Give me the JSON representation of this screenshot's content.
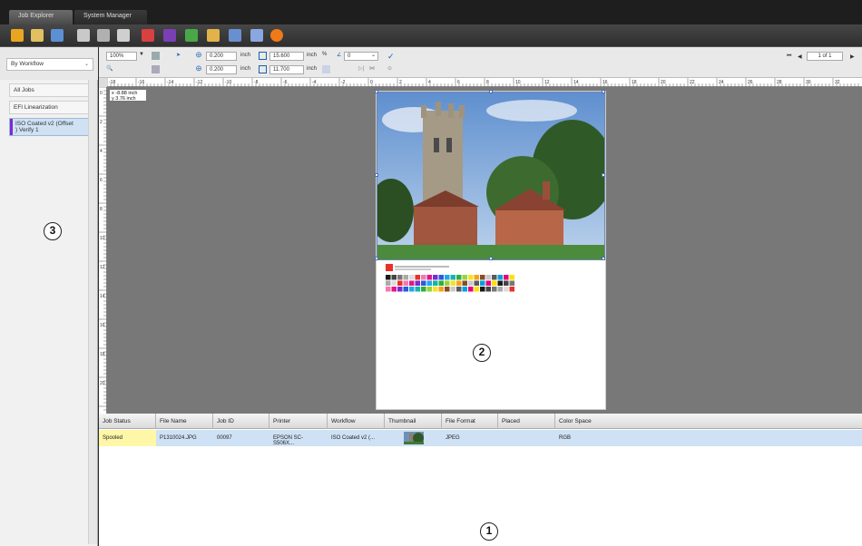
{
  "tabs": [
    {
      "label": "Job Explorer",
      "active": true
    },
    {
      "label": "System Manager",
      "active": false
    }
  ],
  "toolbar_icons": [
    "open-folder-icon",
    "folder-icon",
    "save-icon",
    "print-icon",
    "printer-settings-icon",
    "printer-icon",
    "delete-icon",
    "color-icon",
    "image-edit-icon",
    "layout-icon",
    "document-icon",
    "page-icon",
    "stop-icon"
  ],
  "left_panel": {
    "workflow_select": "By Workflow",
    "items": [
      {
        "label": "All Jobs"
      },
      {
        "label": "EFI Linearization"
      },
      {
        "label_line1": "ISO Coated v2 (Offset",
        "label_line2": ") Verify 1",
        "selected": true
      }
    ]
  },
  "options": {
    "zoom": "100%",
    "x_pos": "0.200",
    "y_pos": "0.200",
    "width": "15.600",
    "height": "11.700",
    "unit": "inch",
    "rotation": "0",
    "page_indicator": "1 of 1"
  },
  "canvas": {
    "coords_line1": "x -8.88 inch",
    "coords_line2": "y 3.76 inch"
  },
  "ruler_h": [
    "-18",
    "-16",
    "-14",
    "-12",
    "-10",
    "-8",
    "-6",
    "-4",
    "-2",
    "0",
    "2",
    "4",
    "6",
    "8",
    "10",
    "12",
    "14",
    "16",
    "18",
    "20",
    "22",
    "24",
    "26",
    "28",
    "30",
    "32"
  ],
  "ruler_v": [
    "0",
    "2",
    "4",
    "6",
    "8",
    "10",
    "12",
    "14",
    "16",
    "18",
    "20"
  ],
  "table": {
    "columns": [
      "Job Status",
      "File Name",
      "Job ID",
      "Printer",
      "Workflow",
      "Thumbnail",
      "File Format",
      "Placed",
      "Color Space"
    ],
    "rows": [
      {
        "status": "Spooled",
        "file_name": "P1310024.JPG",
        "job_id": "00097",
        "printer": "EPSON SC-S506X...",
        "workflow": "ISO Coated v2 (...",
        "file_format": "JPEG",
        "placed": "",
        "color_space": "RGB"
      }
    ]
  },
  "callouts": [
    "1",
    "2",
    "3"
  ],
  "colors": {
    "selected_accent": "#7a2bd0",
    "row_highlight": "#cfe2f5",
    "status_bg": "#fff7a8"
  }
}
